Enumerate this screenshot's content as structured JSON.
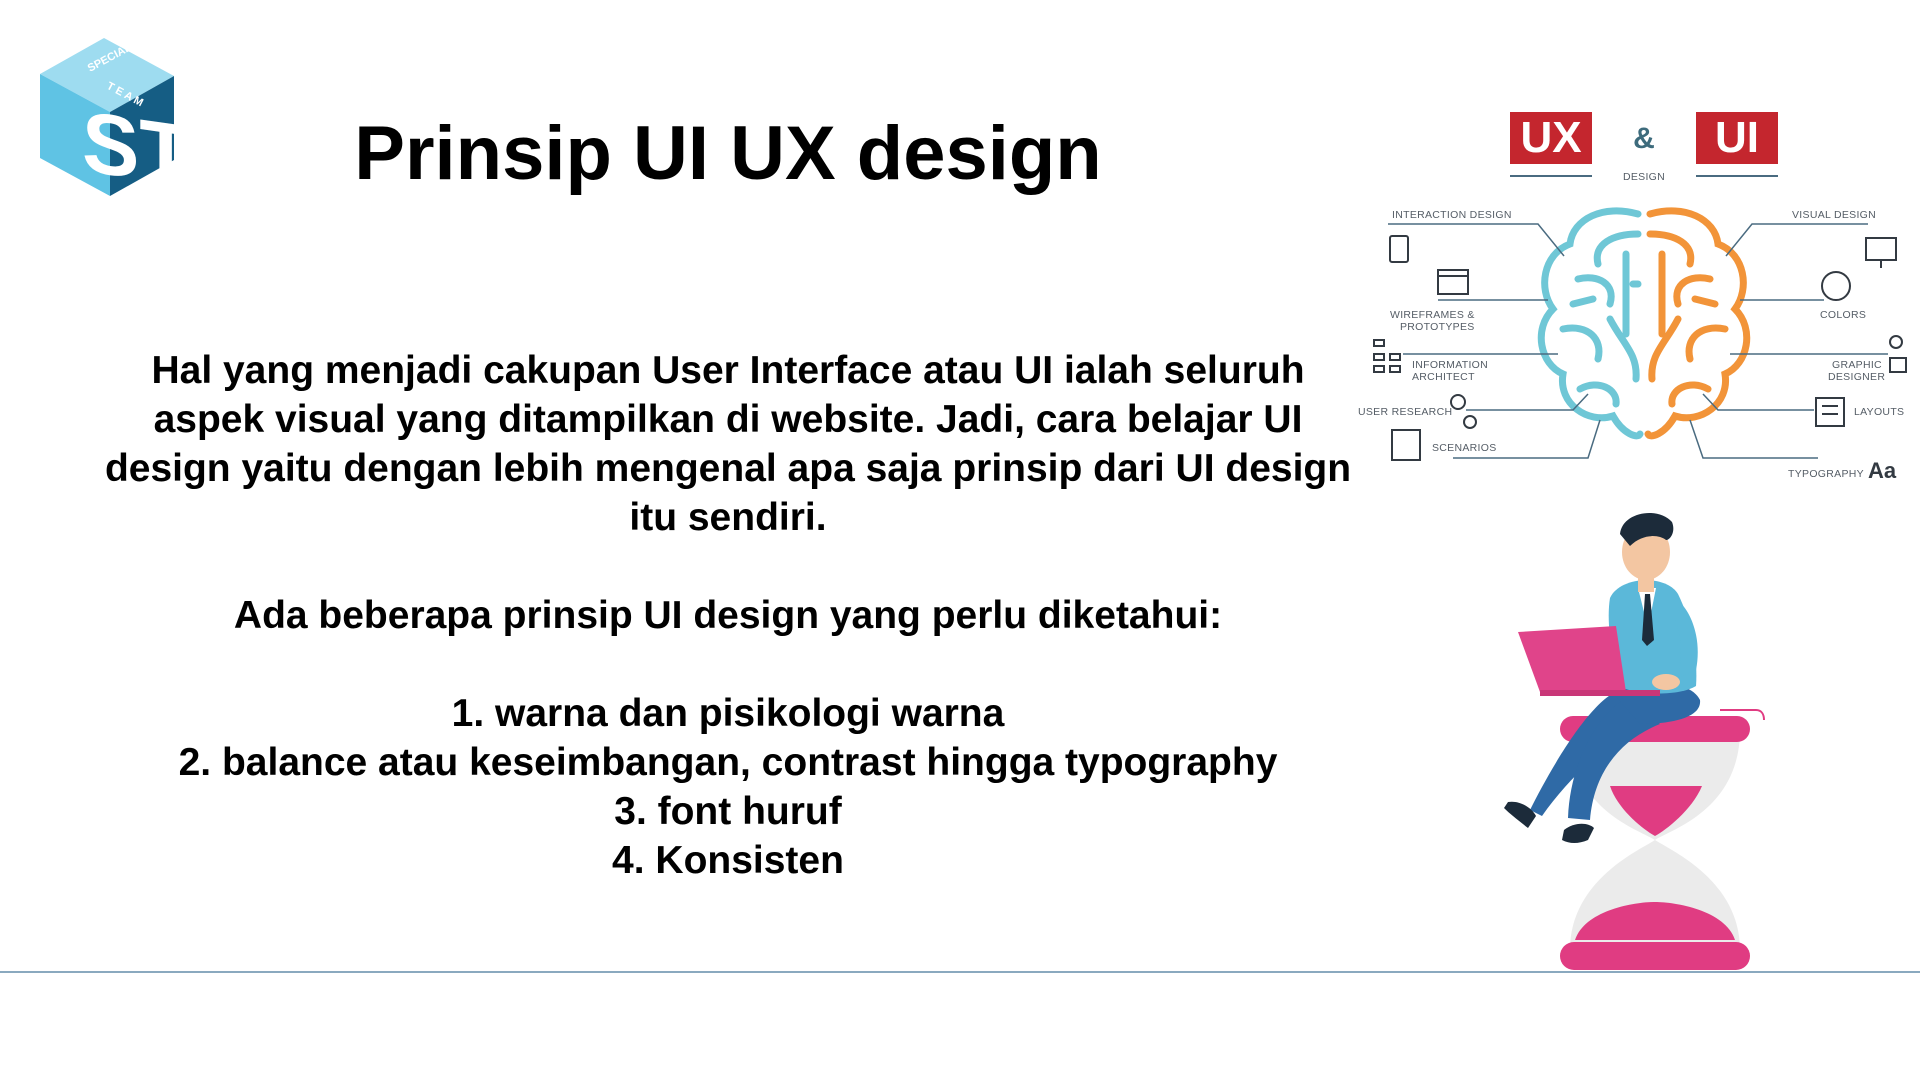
{
  "logo": {
    "letters": "ST",
    "side_text": "SPECIAL",
    "side_text_2": "T E A M",
    "colors": {
      "light": "#5fc3e4",
      "dark": "#155d84",
      "top": "#9edcf0"
    }
  },
  "slide": {
    "title": "Prinsip UI UX design",
    "paragraph": "Hal yang menjadi cakupan User Interface atau UI ialah seluruh aspek visual yang ditampilkan di website. Jadi, cara belajar UI design yaitu dengan lebih mengenal apa saja prinsip dari UI design itu sendiri.",
    "intro": "Ada beberapa prinsip UI design yang perlu diketahui:",
    "principles": [
      "1. warna dan pisikologi warna",
      "2. balance atau keseimbangan, contrast hingga typography",
      "3. font huruf",
      "4. Konsisten"
    ]
  },
  "infographic": {
    "ux_badge": "UX",
    "ui_badge": "UI",
    "ampersand": "&",
    "design_label": "DESIGN",
    "left_labels": [
      "INTERACTION DESIGN",
      "WIREFRAMES &",
      "PROTOTYPES",
      "INFORMATION",
      "ARCHITECT",
      "USER RESEARCH",
      "SCENARIOS"
    ],
    "right_labels": [
      "VISUAL DESIGN",
      "COLORS",
      "GRAPHIC",
      "DESIGNER",
      "LAYOUTS",
      "TYPOGRAPHY"
    ],
    "typography_glyph": "Aa",
    "colors": {
      "badge": "#c4262e",
      "left_brain": "#6fc7d6",
      "right_brain": "#f29439",
      "line": "#4a6b80"
    }
  },
  "illustration": {
    "colors": {
      "shirt": "#5bb8d9",
      "pants": "#2f6aa6",
      "laptop": "#e0448a",
      "hourglass": "#e03c82",
      "glass": "#ebebeb",
      "hair": "#1c2b3a"
    }
  }
}
